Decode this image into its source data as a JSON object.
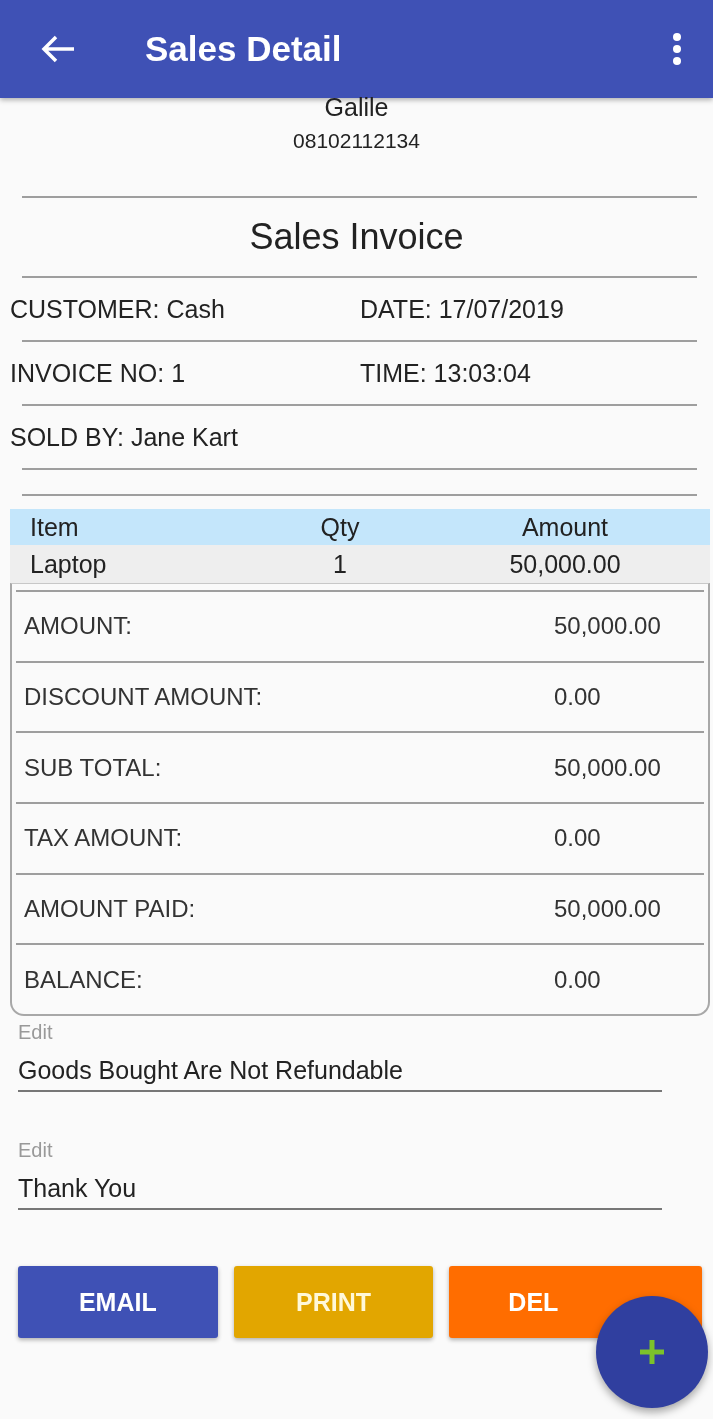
{
  "app_bar": {
    "title": "Sales Detail"
  },
  "store": {
    "name": "Galile",
    "phone": "08102112134"
  },
  "invoice_title": "Sales Invoice",
  "info_rows": [
    [
      "CUSTOMER: Cash",
      "DATE: 17/07/2019"
    ],
    [
      "INVOICE NO: 1",
      "TIME: 13:03:04"
    ],
    [
      "SOLD BY: Jane Kart"
    ]
  ],
  "items_table": {
    "columns": [
      "Item",
      "Qty",
      "Amount"
    ],
    "rows": [
      [
        "Laptop",
        "1",
        "50,000.00"
      ]
    ]
  },
  "summary": [
    {
      "label": "AMOUNT:",
      "value": "50,000.00"
    },
    {
      "label": "DISCOUNT AMOUNT:",
      "value": "0.00"
    },
    {
      "label": "SUB TOTAL:",
      "value": "50,000.00"
    },
    {
      "label": "TAX AMOUNT:",
      "value": "0.00"
    },
    {
      "label": "AMOUNT PAID:",
      "value": "50,000.00"
    },
    {
      "label": "BALANCE:",
      "value": "0.00"
    }
  ],
  "notes": [
    {
      "label": "Edit",
      "value": "Goods Bought Are Not Refundable"
    },
    {
      "label": "Edit",
      "value": "Thank You"
    }
  ],
  "buttons": [
    {
      "label": "EMAIL",
      "color": "#3f51b5"
    },
    {
      "label": "PRINT",
      "color": "#e2a600"
    },
    {
      "label": "DEL",
      "color": "#ff6d00"
    }
  ]
}
